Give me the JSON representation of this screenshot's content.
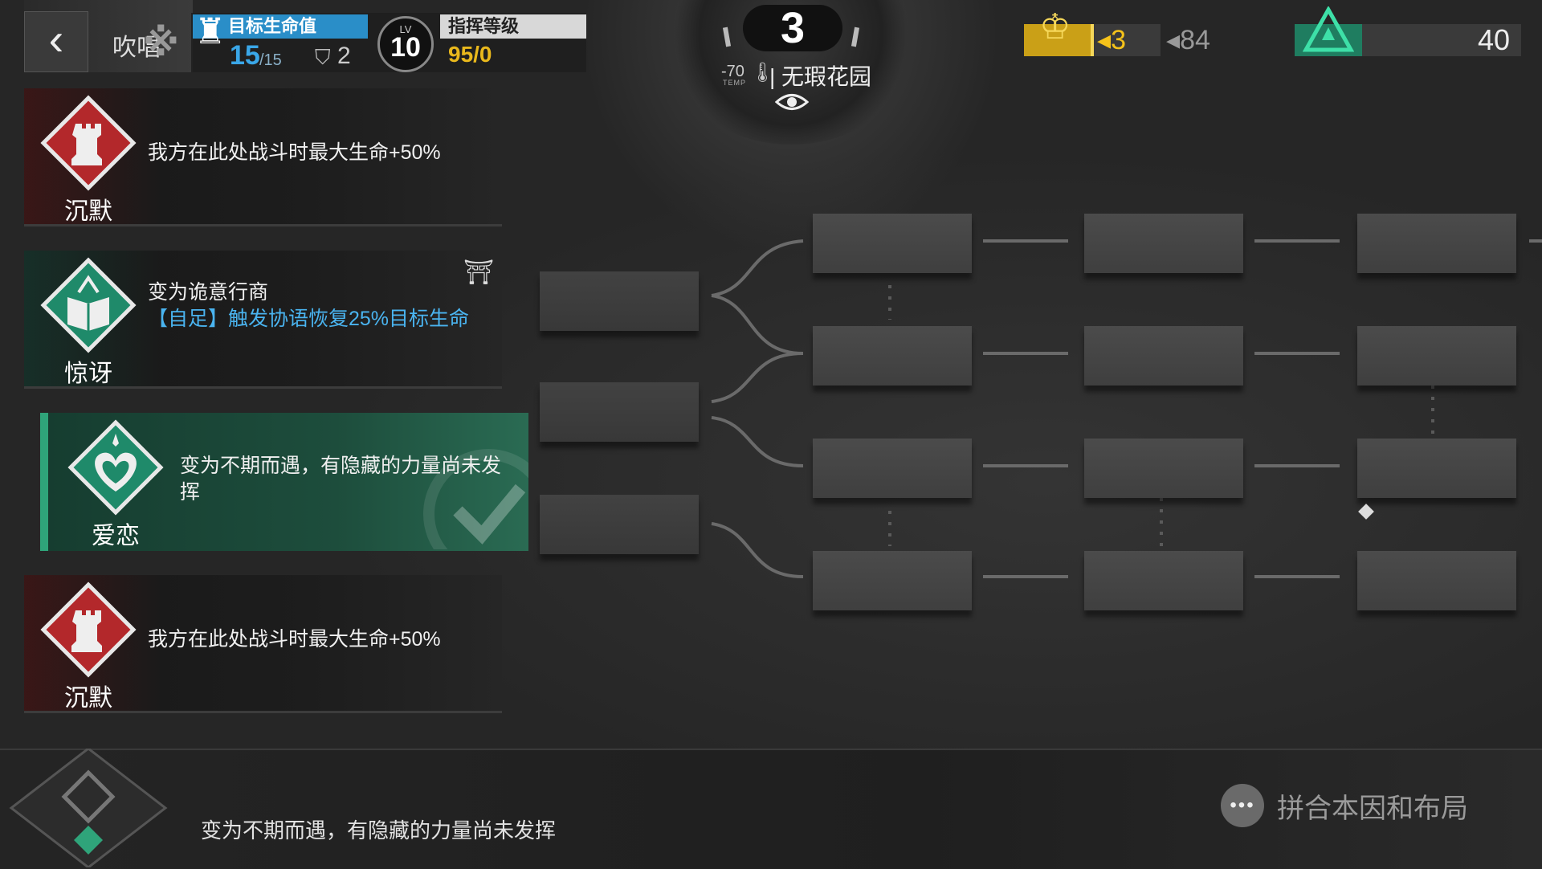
{
  "top_bar": {
    "back_icon": "chevron-left-icon",
    "prev_card_name": "吹唱",
    "hp_label": "目标生命值",
    "hp_current": "15",
    "hp_max": "/15",
    "shield": "2",
    "lv_tag": "LV",
    "lv": "10",
    "command_label": "指挥等级",
    "command_value": "95/0",
    "round": "3",
    "temp_value": "-70",
    "temp_tag": "TEMP",
    "stage_name": "| 无瑕花园",
    "gold_delta": "◂3",
    "gold_total": "◂84",
    "triangle_value": "40",
    "colors": {
      "hp_accent": "#2a8ec8",
      "gold": "#caa017",
      "triangle": "#1f7d60"
    }
  },
  "cards": [
    {
      "type": "沉默",
      "icon": "red-rook-icon",
      "desc": "我方在此处战斗时最大生命+50%"
    },
    {
      "type": "惊讶",
      "icon": "green-book-icon",
      "desc_line1": "变为诡意行商",
      "desc_line2": "【自足】触发协语恢复25%目标生命"
    },
    {
      "type": "爱恋",
      "icon": "green-heart-icon",
      "desc": "变为不期而遇，有隐藏的力量尚未发挥",
      "selected": true
    },
    {
      "type": "沉默",
      "icon": "red-rook-icon",
      "desc": "我方在此处战斗时最大生命+50%"
    }
  ],
  "bottom": {
    "desc": "变为不期而遇，有隐藏的力量尚未发挥",
    "combine_icon_glyph": "•••",
    "combine_label": "拼合本因和布局"
  }
}
